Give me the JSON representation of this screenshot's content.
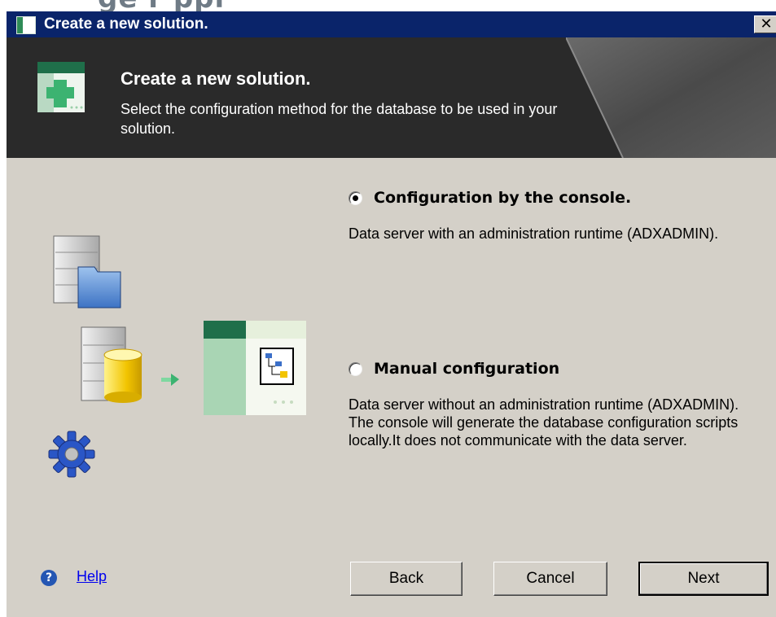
{
  "background_text": "ge   r   ppl",
  "window": {
    "title": "Create a new solution.",
    "close_label": "✕"
  },
  "header": {
    "title": "Create a new solution.",
    "subtitle": "Select the configuration method for the database to be used in your solution."
  },
  "options": [
    {
      "label": "Configuration by the console.",
      "selected": true,
      "description": "Data server with an administration runtime (ADXADMIN)."
    },
    {
      "label": "Manual configuration",
      "selected": false,
      "description": "Data server without an administration runtime (ADXADMIN). The console will generate the database configuration scripts locally.It does not communicate with the data server."
    }
  ],
  "footer": {
    "help_label": "Help",
    "back_label": "Back",
    "cancel_label": "Cancel",
    "next_label": "Next"
  },
  "icons": {
    "app": "app-window-icon",
    "header": "add-solution-icon",
    "server_folder": "server-folder-icon",
    "server_database": "server-database-icon",
    "arrow": "arrow-right-icon",
    "console": "console-window-icon",
    "gear": "gear-icon",
    "help": "help-icon"
  },
  "colors": {
    "titlebar": "#0a246a",
    "banner": "#2a2a2a",
    "dialog_bg": "#d4d0c8",
    "accent_green": "#2e8b57",
    "link": "#0000ee"
  }
}
